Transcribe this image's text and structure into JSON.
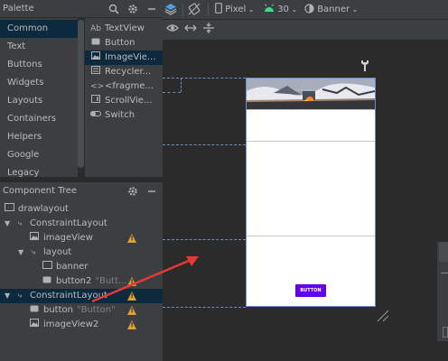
{
  "palette": {
    "title": "Palette",
    "categories": [
      "Common",
      "Text",
      "Buttons",
      "Widgets",
      "Layouts",
      "Containers",
      "Helpers",
      "Google",
      "Legacy"
    ],
    "selected_category": "Common",
    "items": [
      {
        "label": "TextView",
        "icon": "Ab"
      },
      {
        "label": "Button",
        "icon": "button-icon"
      },
      {
        "label": "ImageVie...",
        "icon": "image-icon"
      },
      {
        "label": "Recycler...",
        "icon": "list-icon"
      },
      {
        "label": "<fragme...",
        "icon": "code-icon"
      },
      {
        "label": "ScrollVie...",
        "icon": "scroll-icon"
      },
      {
        "label": "Switch",
        "icon": "switch-icon"
      }
    ],
    "text_icon": "Ab"
  },
  "component_tree": {
    "title": "Component Tree",
    "rows": [
      {
        "label": "drawlayout",
        "hint": ""
      },
      {
        "label": "ConstraintLayout",
        "hint": ""
      },
      {
        "label": "imageView",
        "hint": ""
      },
      {
        "label": "layout",
        "hint": ""
      },
      {
        "label": "banner",
        "hint": ""
      },
      {
        "label": "button2",
        "hint": "\"Butt..."
      },
      {
        "label": "ConstraintLayout",
        "hint": ""
      },
      {
        "label": "button",
        "hint": "\"Button\""
      },
      {
        "label": "imageView2",
        "hint": ""
      }
    ]
  },
  "toolbar": {
    "device": "Pixel",
    "api": "30",
    "theme": "Banner"
  },
  "preview": {
    "button_label": "BUTTON"
  },
  "colors": {
    "accent_button": "#6200ee",
    "selection": "#0d293e",
    "warning": "#e0a030",
    "arrow": "#e53935"
  }
}
